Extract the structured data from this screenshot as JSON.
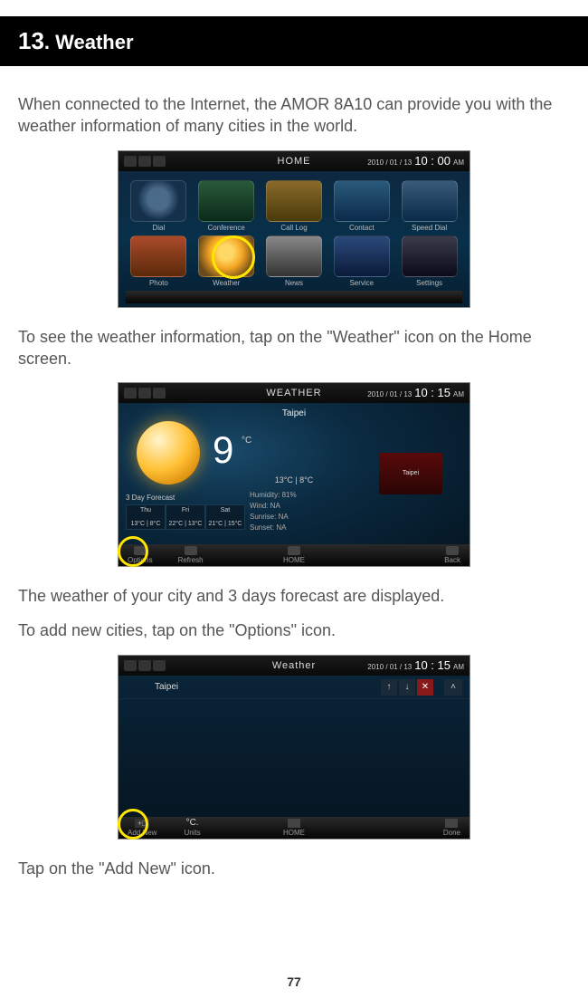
{
  "chapter": {
    "number": "13",
    "title": ". Weather"
  },
  "para1": "When connected to the Internet, the AMOR 8A10 can provide you with the weather information of many cities in the world.",
  "para2": "To see the weather information, tap on the \"Weather\" icon on the Home screen.",
  "para3": "The weather of your city and 3 days forecast are displayed.",
  "para4": "To add new cities, tap on the \"Options\" icon.",
  "para5": "Tap on the \"Add New\" icon.",
  "page_number": "77",
  "screen1": {
    "status_title": "HOME",
    "date": "2010 / 01 / 13",
    "time": "10 : 00",
    "ampm": "AM",
    "apps": [
      {
        "label": "Dial",
        "cls": "dial-shape"
      },
      {
        "label": "Conference",
        "cls": "conf-shape"
      },
      {
        "label": "Call Log",
        "cls": "log-shape"
      },
      {
        "label": "Contact",
        "cls": "contact-shape"
      },
      {
        "label": "Speed Dial",
        "cls": "speed-shape"
      },
      {
        "label": "Photo",
        "cls": "photo-shape"
      },
      {
        "label": "Weather",
        "cls": "weather-shape"
      },
      {
        "label": "News",
        "cls": "news-shape"
      },
      {
        "label": "Service",
        "cls": "service-shape"
      },
      {
        "label": "Settings",
        "cls": "settings-shape"
      }
    ]
  },
  "screen2": {
    "status_title": "WEATHER",
    "date": "2010 / 01 / 13",
    "time": "10 : 15",
    "ampm": "AM",
    "city": "Taipei",
    "temp": "9",
    "unit": "°C",
    "range": "13°C   |   8°C",
    "humidity": "Humidity: 81%",
    "wind": "Wind: NA",
    "sunrise": "Sunrise: NA",
    "sunset": "Sunset: NA",
    "cond_label": "Taipei",
    "forecast_label": "3 Day Forecast",
    "forecast": [
      {
        "day": "Thu",
        "range": "13°C | 8°C"
      },
      {
        "day": "Fri",
        "range": "22°C | 13°C"
      },
      {
        "day": "Sat",
        "range": "21°C | 15°C"
      }
    ],
    "toolbar": {
      "options": "Options",
      "refresh": "Refresh",
      "home": "HOME",
      "back": "Back"
    }
  },
  "screen3": {
    "status_title": "Weather",
    "date": "2010 / 01 / 13",
    "time": "10 : 15",
    "ampm": "AM",
    "city_row": "Taipei",
    "toolbar": {
      "addnew": "Add New",
      "units": "Units",
      "units_symbol": "°C.",
      "home": "HOME",
      "done": "Done"
    }
  }
}
